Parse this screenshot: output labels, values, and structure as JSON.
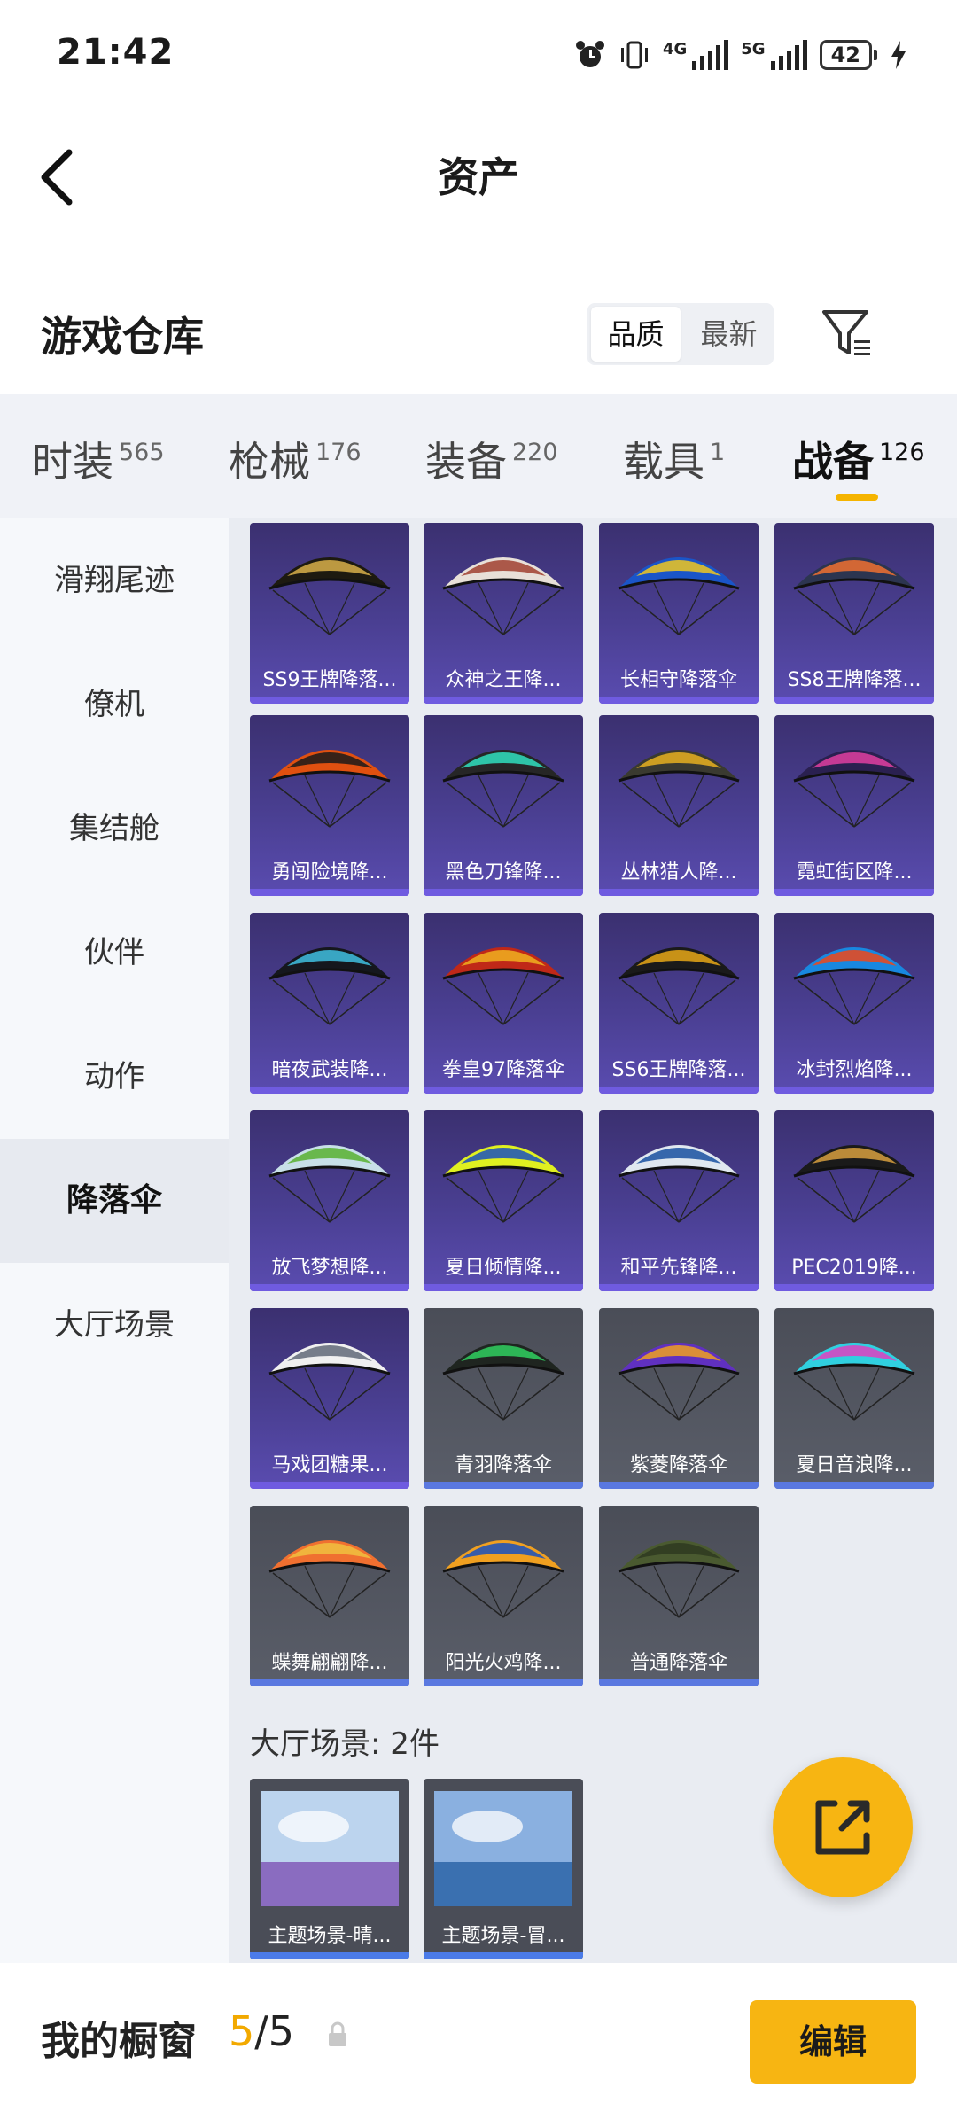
{
  "status_bar": {
    "time": "21:42",
    "network_1": "4G",
    "network_2": "5G",
    "battery": "42"
  },
  "header": {
    "title": "资产"
  },
  "warehouse": {
    "title": "游戏仓库",
    "sort_options": [
      "品质",
      "最新"
    ],
    "selected_sort": "品质"
  },
  "tabs": [
    {
      "label": "时装",
      "count": "565"
    },
    {
      "label": "枪械",
      "count": "176"
    },
    {
      "label": "装备",
      "count": "220"
    },
    {
      "label": "载具",
      "count": "1"
    },
    {
      "label": "战备",
      "count": "126"
    }
  ],
  "active_tab": "战备",
  "sidebar": {
    "items": [
      "滑翔尾迹",
      "僚机",
      "集结舱",
      "伙伴",
      "动作",
      "降落伞",
      "大厅场景"
    ],
    "active": "降落伞"
  },
  "parachutes": [
    {
      "name": "SS9王牌降落...",
      "icon": "parachute-icon",
      "colors": [
        "#1d1a10",
        "#d8b04a"
      ]
    },
    {
      "name": "众神之王降...",
      "icon": "parachute-icon",
      "colors": [
        "#e8e0d8",
        "#a04030"
      ]
    },
    {
      "name": "长相守降落伞",
      "icon": "parachute-icon",
      "colors": [
        "#1a55c8",
        "#f0c820"
      ]
    },
    {
      "name": "SS8王牌降落...",
      "icon": "parachute-icon",
      "colors": [
        "#2c3550",
        "#f07030"
      ]
    },
    {
      "name": "勇闯险境降...",
      "icon": "parachute-icon",
      "colors": [
        "#e05010",
        "#1a1a1a"
      ]
    },
    {
      "name": "黑色刀锋降...",
      "icon": "parachute-icon",
      "colors": [
        "#262626",
        "#30e0c0"
      ]
    },
    {
      "name": "丛林猎人降...",
      "icon": "parachute-icon",
      "colors": [
        "#3a3a30",
        "#e8b020"
      ]
    },
    {
      "name": "霓虹街区降...",
      "icon": "parachute-icon",
      "colors": [
        "#2a2050",
        "#e040a0"
      ]
    },
    {
      "name": "暗夜武装降...",
      "icon": "parachute-icon",
      "colors": [
        "#15171d",
        "#40c0e0"
      ]
    },
    {
      "name": "拳皇97降落伞",
      "icon": "parachute-icon",
      "colors": [
        "#c02818",
        "#f0b020"
      ]
    },
    {
      "name": "SS6王牌降落...",
      "icon": "parachute-icon",
      "colors": [
        "#1a1a1a",
        "#e8a818"
      ]
    },
    {
      "name": "冰封烈焰降...",
      "icon": "parachute-icon",
      "colors": [
        "#1888e0",
        "#f04818"
      ]
    },
    {
      "name": "放飞梦想降...",
      "icon": "parachute-icon",
      "colors": [
        "#c8e0e8",
        "#58b030"
      ]
    },
    {
      "name": "夏日倾情降...",
      "icon": "parachute-icon",
      "colors": [
        "#e0f020",
        "#1850c0"
      ]
    },
    {
      "name": "和平先锋降...",
      "icon": "parachute-icon",
      "colors": [
        "#e0e8f0",
        "#1850a0"
      ]
    },
    {
      "name": "PEC2019降...",
      "icon": "parachute-icon",
      "colors": [
        "#1a1a1a",
        "#d8a040"
      ]
    },
    {
      "name": "马戏团糖果...",
      "icon": "parachute-icon",
      "colors": [
        "#f0f0f0",
        "#606878"
      ]
    },
    {
      "name": "青羽降落伞",
      "icon": "parachute-icon",
      "colors": [
        "#1f2520",
        "#30d060"
      ]
    },
    {
      "name": "紫菱降落伞",
      "icon": "parachute-icon",
      "colors": [
        "#6030c0",
        "#f0a020"
      ]
    },
    {
      "name": "夏日音浪降...",
      "icon": "parachute-icon",
      "colors": [
        "#30d0e0",
        "#e040c0"
      ]
    },
    {
      "name": "蝶舞翩翩降...",
      "icon": "parachute-icon",
      "colors": [
        "#f07030",
        "#f0c040"
      ]
    },
    {
      "name": "阳光火鸡降...",
      "icon": "parachute-icon",
      "colors": [
        "#f0a020",
        "#1850c0"
      ]
    },
    {
      "name": "普通降落伞",
      "icon": "parachute-icon",
      "colors": [
        "#4a5a30",
        "#2e3a20"
      ]
    }
  ],
  "lobby_scenes": {
    "section_title": "大厅场景: 2件",
    "items": [
      {
        "name": "主题场景-晴...",
        "icon": "scene-thumbnail-icon",
        "colors": [
          "#bcd4ee",
          "#8a6cc0"
        ]
      },
      {
        "name": "主题场景-冒...",
        "icon": "scene-thumbnail-icon",
        "colors": [
          "#8ab0e0",
          "#3a70b0"
        ]
      }
    ]
  },
  "bottom_bar": {
    "label": "我的橱窗",
    "count_current": "5",
    "count_total": "/5",
    "edit_label": "编辑"
  }
}
